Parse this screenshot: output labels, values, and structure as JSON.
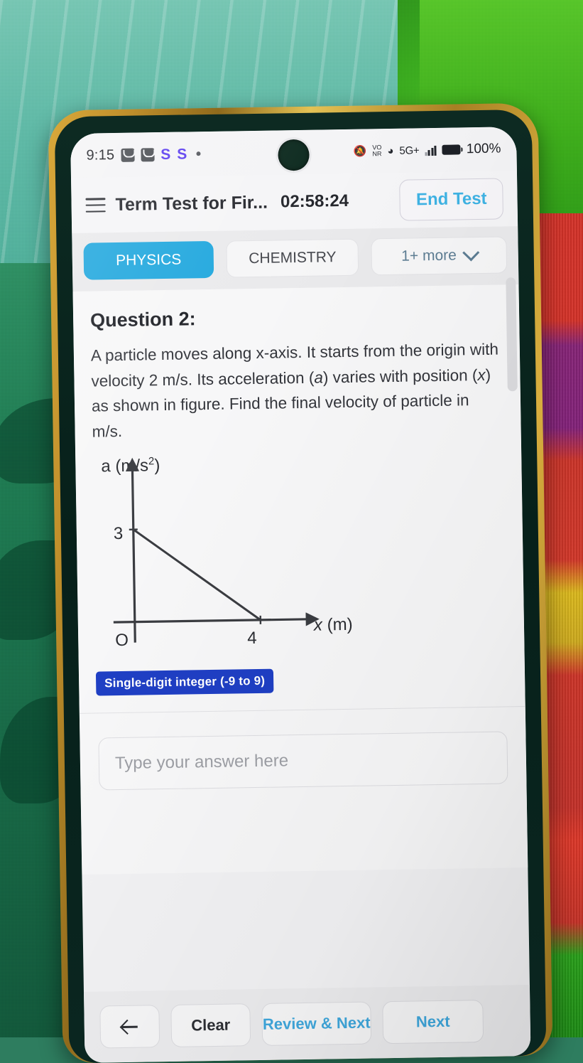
{
  "status_bar": {
    "time": "9:15",
    "app_icons": [
      "mail-icon",
      "mail-icon"
    ],
    "letters": [
      "S",
      "S"
    ],
    "dot": "•",
    "mute_icon": "bell-off-icon",
    "nr_top": "VO",
    "nr_bottom": "NR",
    "wifi_icon": "hotspot-icon",
    "network": "5G+",
    "signal_icon": "signal-bars-icon",
    "battery_icon": "battery-full-icon",
    "battery_percent": "100%"
  },
  "header": {
    "menu_icon": "hamburger-icon",
    "title": "Term Test for Fir...",
    "timer": "02:58:24",
    "end_test_label": "End Test",
    "end_test_color": "#3fb3e4"
  },
  "tabs": {
    "items": [
      {
        "label": "PHYSICS",
        "active": true
      },
      {
        "label": "CHEMISTRY",
        "active": false
      },
      {
        "label": "1+ more",
        "active": false,
        "icon": "chevron-down-icon"
      }
    ],
    "active_color": "#22a8de"
  },
  "question": {
    "title": "Question 2:",
    "text_line1": "A particle moves along x-axis. It starts from the origin",
    "text_line2_a": "with velocity 2 m/s. Its acceleration (",
    "text_line2_italic": "a",
    "text_line2_b": ") varies with",
    "text_line3_a": "position (",
    "text_line3_italic": "x",
    "text_line3_b": ") as shown in figure. Find the final velocity of",
    "text_line4": "particle in m/s.",
    "answer_type_badge": "Single-digit integer (-9 to 9)",
    "badge_color": "#1f3fc4"
  },
  "chart_data": {
    "type": "line",
    "title": "",
    "xlabel": "x (m)",
    "ylabel": "a (m/s2)",
    "ylabel_base": "a (m/s",
    "ylabel_exp": "2",
    "ylabel_close": ")",
    "origin_label": "O",
    "x_ticks": [
      "4"
    ],
    "y_ticks": [
      "3"
    ],
    "xlim": [
      0,
      5.6
    ],
    "ylim": [
      0,
      4.2
    ],
    "grid": false,
    "legend": "none",
    "series": [
      {
        "name": "acceleration vs position",
        "x": [
          0,
          4
        ],
        "y": [
          3,
          0
        ]
      }
    ]
  },
  "answer_field": {
    "placeholder": "Type your answer here",
    "value": ""
  },
  "bottom_bar": {
    "back_icon": "arrow-left-icon",
    "clear_label": "Clear",
    "review_next_label": "Review & Next",
    "next_label": "Next",
    "link_color": "#3fa7dc"
  }
}
